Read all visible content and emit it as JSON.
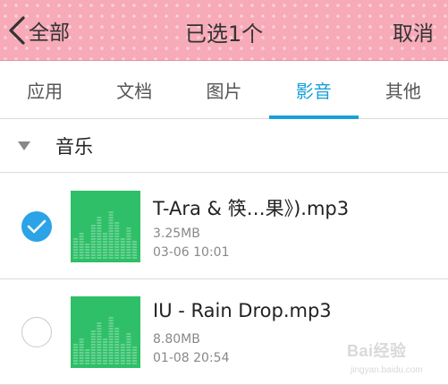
{
  "header": {
    "back_label": "全部",
    "title": "已选1个",
    "cancel_label": "取消"
  },
  "tabs": [
    {
      "label": "应用",
      "active": false
    },
    {
      "label": "文档",
      "active": false
    },
    {
      "label": "图片",
      "active": false
    },
    {
      "label": "影音",
      "active": true
    },
    {
      "label": "其他",
      "active": false
    }
  ],
  "section": {
    "label": "音乐",
    "icon": "triangle-down-icon"
  },
  "files": [
    {
      "name": "T-Ara & 筷…果》).mp3",
      "size": "3.25MB",
      "date": "03-06 10:01",
      "selected": true
    },
    {
      "name": "IU - Rain Drop.mp3",
      "size": "8.80MB",
      "date": "01-08 20:54",
      "selected": false
    }
  ],
  "watermark": {
    "brand": "Bai经验",
    "url": "jingyan.baidu.com"
  },
  "colors": {
    "header_bg": "#f7aab8",
    "accent": "#1aa0d8",
    "check": "#2ba3e6",
    "thumb": "#2fbf68"
  }
}
